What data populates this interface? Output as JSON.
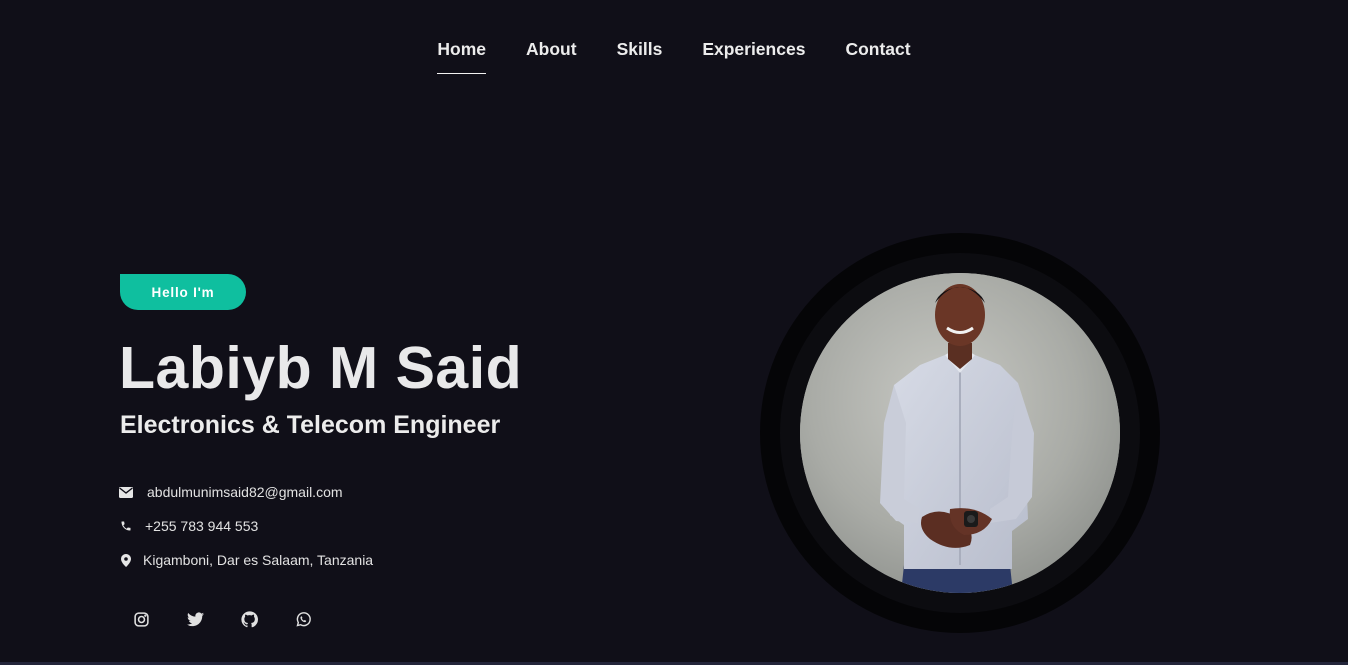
{
  "nav": {
    "items": [
      {
        "label": "Home",
        "active": true
      },
      {
        "label": "About",
        "active": false
      },
      {
        "label": "Skills",
        "active": false
      },
      {
        "label": "Experiences",
        "active": false
      },
      {
        "label": "Contact",
        "active": false
      }
    ]
  },
  "hero": {
    "badge": "Hello I'm",
    "name": "Labiyb M Said",
    "role": "Electronics & Telecom Engineer"
  },
  "contact": {
    "email": {
      "icon": "envelope-icon",
      "text": "abdulmunimsaid82@gmail.com"
    },
    "phone": {
      "icon": "phone-icon",
      "text": "+255 783 944 553"
    },
    "location": {
      "icon": "map-marker-icon",
      "text": "Kigamboni, Dar es Salaam, Tanzania"
    }
  },
  "socials": [
    "instagram-icon",
    "twitter-icon",
    "github-icon",
    "whatsapp-icon"
  ],
  "colors": {
    "background": "#100f18",
    "accent": "#0fbf9f",
    "text": "#ececec"
  }
}
